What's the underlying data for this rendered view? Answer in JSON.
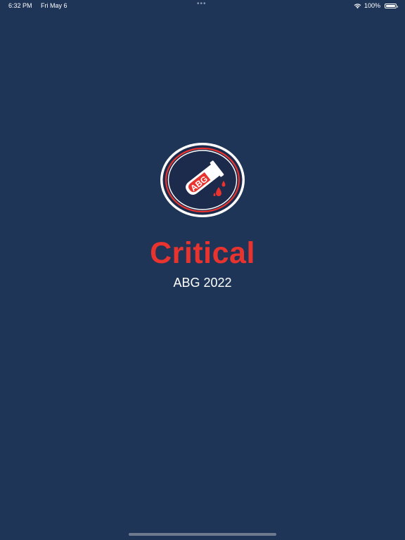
{
  "status_bar": {
    "time": "6:32 PM",
    "date": "Fri May 6",
    "multitask_dots": "•••",
    "battery_percent": "100%",
    "battery_level": 1.0,
    "icons": [
      "wifi-icon",
      "battery-icon"
    ]
  },
  "splash": {
    "logo_text": "ABG",
    "title": "Critical",
    "subtitle": "ABG 2022"
  },
  "colors": {
    "background": "#1e3558",
    "accent_red": "#e8332e",
    "text_white": "#ffffff",
    "logo_circle": "#1c2a4c"
  }
}
